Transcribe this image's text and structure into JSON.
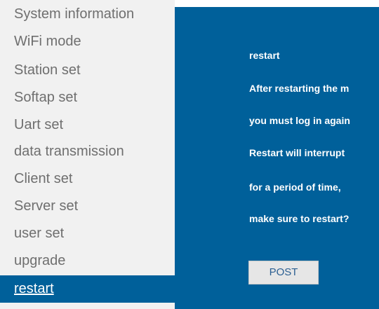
{
  "sidebar": {
    "items": [
      {
        "label": "System information"
      },
      {
        "label": "WiFi mode"
      },
      {
        "label": "Station set"
      },
      {
        "label": "Softap set"
      },
      {
        "label": "Uart set"
      },
      {
        "label": "data transmission"
      },
      {
        "label": "Client set"
      },
      {
        "label": "Server set"
      },
      {
        "label": "user set"
      },
      {
        "label": "upgrade"
      },
      {
        "label": "restart",
        "active": true
      }
    ]
  },
  "main": {
    "title": "restart",
    "lines": [
      "After restarting the m",
      "you must log in again",
      "Restart will interrupt",
      "for a period of time,",
      "make sure to restart?"
    ],
    "post_label": "POST"
  },
  "colors": {
    "accent": "#00609a",
    "sidebar_bg": "#f1f1f1",
    "sidebar_text": "#6f6f6f",
    "button_bg": "#e6e6e6",
    "button_text": "#2b5f92"
  }
}
